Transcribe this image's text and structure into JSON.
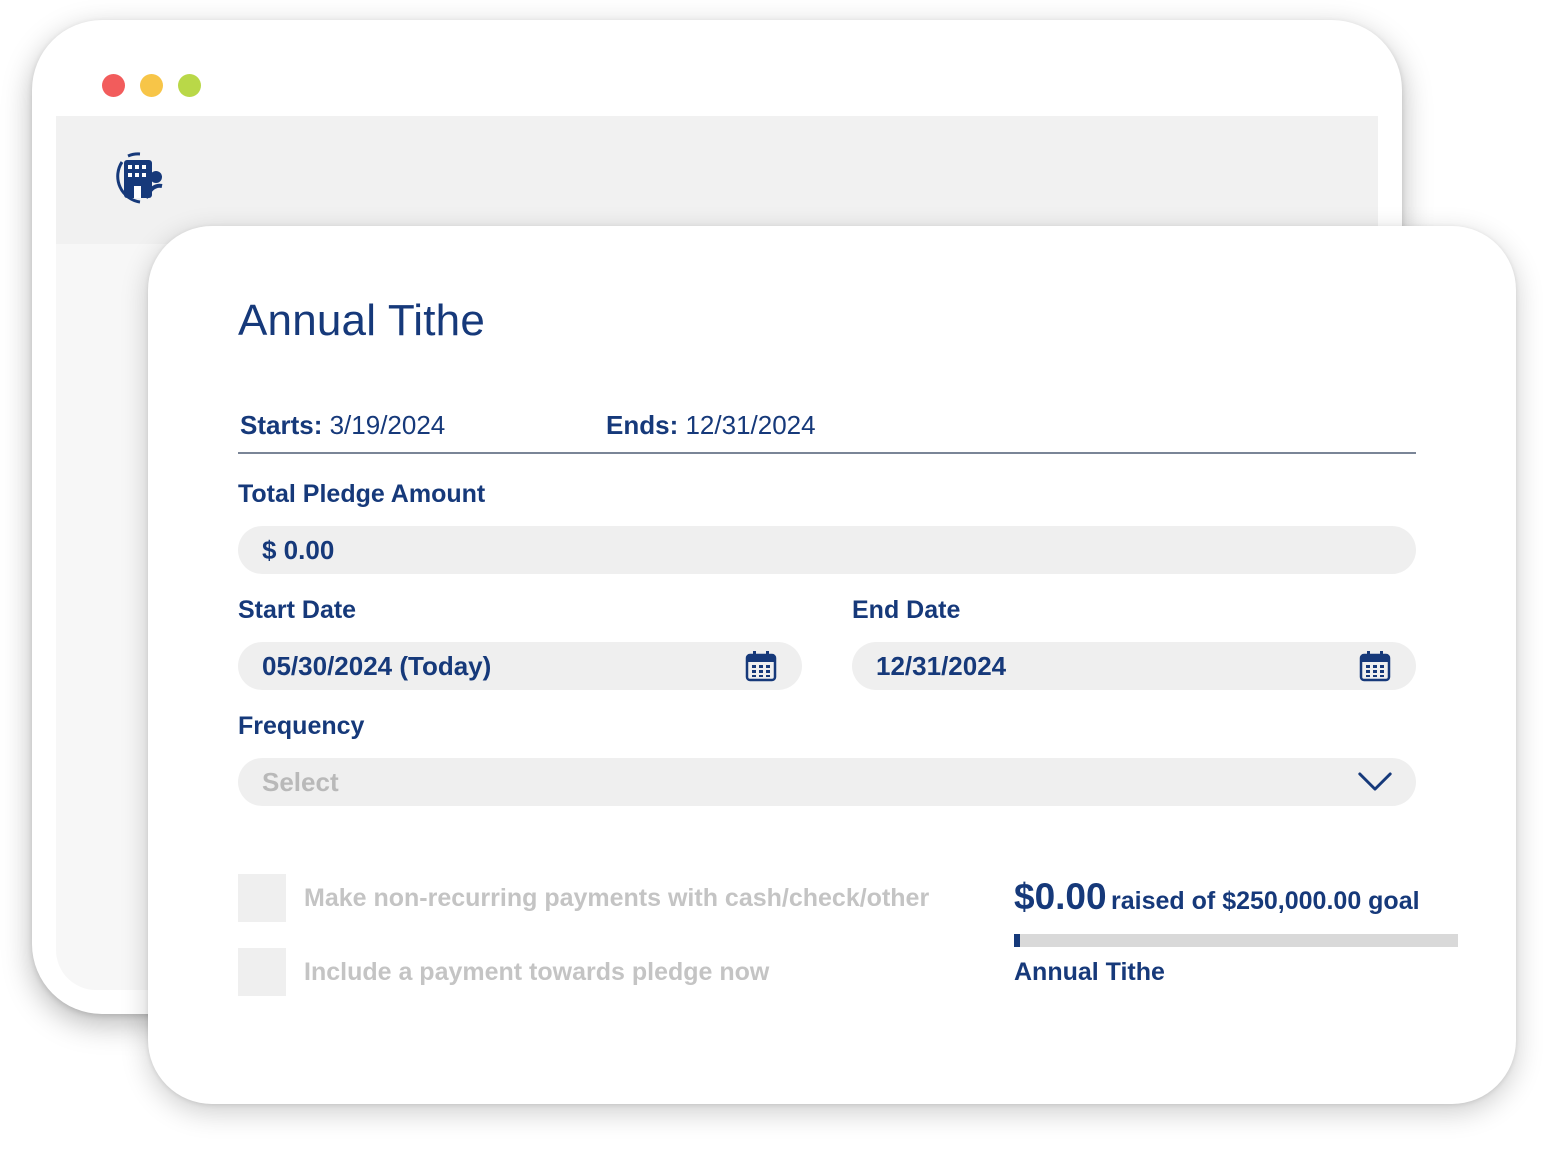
{
  "window": {
    "dots": [
      {
        "name": "close",
        "color": "#f25c5c"
      },
      {
        "name": "minimize",
        "color": "#f7c548"
      },
      {
        "name": "maximize",
        "color": "#b9d848"
      }
    ],
    "logo_icon": "church-building-icon"
  },
  "form": {
    "title": "Annual Tithe",
    "starts_label": "Starts:",
    "starts_value": "3/19/2024",
    "ends_label": "Ends:",
    "ends_value": "12/31/2024",
    "total_pledge_label": "Total Pledge Amount",
    "total_pledge_value": "$ 0.00",
    "start_date_label": "Start Date",
    "start_date_value": "05/30/2024 (Today)",
    "end_date_label": "End Date",
    "end_date_value": "12/31/2024",
    "calendar_icon": "calendar-icon",
    "frequency_label": "Frequency",
    "frequency_placeholder": "Select",
    "dropdown_icon": "chevron-down-icon",
    "option_nonrecurring": "Make non-recurring payments with cash/check/other",
    "option_payment_now": "Include a payment towards pledge now"
  },
  "progress": {
    "raised_amount": "$0.00",
    "raised_text": "raised of $250,000.00 goal",
    "fraction": 0,
    "campaign_label": "Annual Tithe"
  },
  "colors": {
    "brand": "#16397a",
    "field_bg": "#efefef",
    "placeholder": "#b9b9b9",
    "track": "#d9d9d9"
  }
}
